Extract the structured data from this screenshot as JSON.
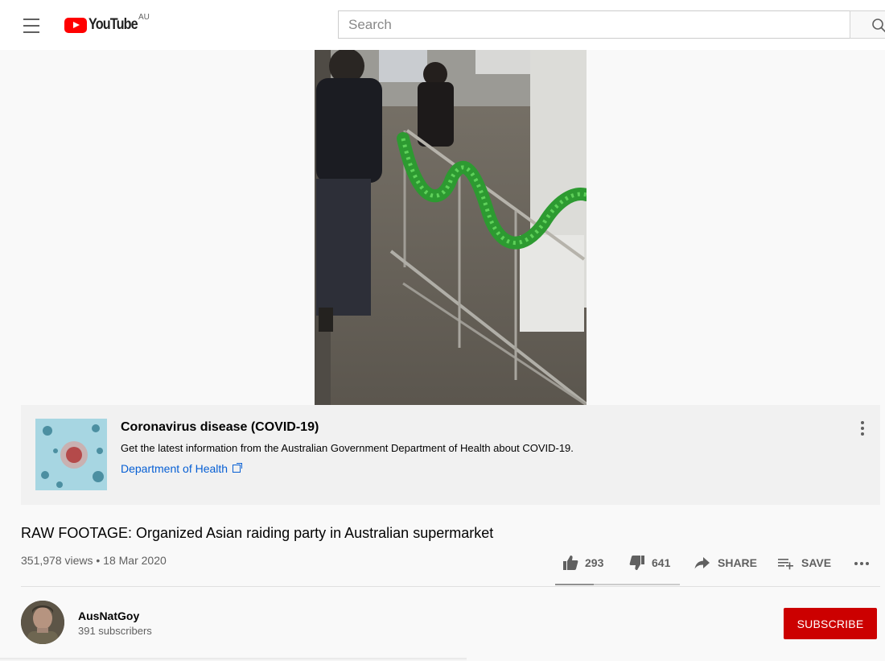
{
  "header": {
    "logo_text": "YouTube",
    "region": "AU",
    "search_placeholder": "Search"
  },
  "info_panel": {
    "title": "Coronavirus disease (COVID-19)",
    "description": "Get the latest information from the Australian Government Department of Health about COVID-19.",
    "link_text": "Department of Health"
  },
  "video": {
    "title": "RAW FOOTAGE: Organized Asian raiding party in Australian supermarket",
    "meta": "351,978 views • 18 Mar 2020",
    "likes": "293",
    "dislikes": "641",
    "like_ratio": 0.31,
    "share_label": "SHARE",
    "save_label": "SAVE"
  },
  "channel": {
    "name": "AusNatGoy",
    "subscribers": "391 subscribers",
    "subscribe_label": "SUBSCRIBE"
  },
  "colors": {
    "brand_red": "#ff0000",
    "subscribe_red": "#cc0000",
    "link_blue": "#065fd4"
  }
}
